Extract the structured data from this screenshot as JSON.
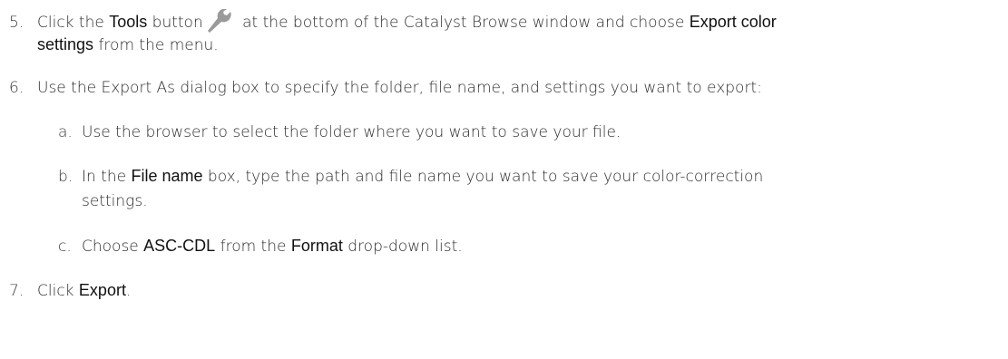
{
  "step5": {
    "number": "5.",
    "text1": "Click the ",
    "tools": "Tools",
    "text2": " button",
    "icon": "wrench-icon",
    "text3": " at the bottom of the Catalyst Browse window and choose ",
    "export_color": "Export color",
    "settings": "settings",
    "text4": " from the menu."
  },
  "step6": {
    "number": "6.",
    "text": "Use the Export As dialog box to specify the folder, file name, and settings you want to export:"
  },
  "sub_a": {
    "letter": "a.",
    "text": "Use the browser to select the folder where you want to save your file."
  },
  "sub_b": {
    "letter": "b.",
    "text1": "In the ",
    "file_name": "File name",
    "text2": " box, type the path and file name you want to save your color-correction",
    "text3": "settings."
  },
  "sub_c": {
    "letter": "c.",
    "text1": "Choose ",
    "asc_cdl": "ASC-CDL",
    "text2": " from the ",
    "format": "Format",
    "text3": " drop-down list."
  },
  "step7": {
    "number": "7.",
    "text1": "Click ",
    "export": "Export",
    "text2": "."
  },
  "colors": {
    "wrench": "#9a9a9a"
  }
}
